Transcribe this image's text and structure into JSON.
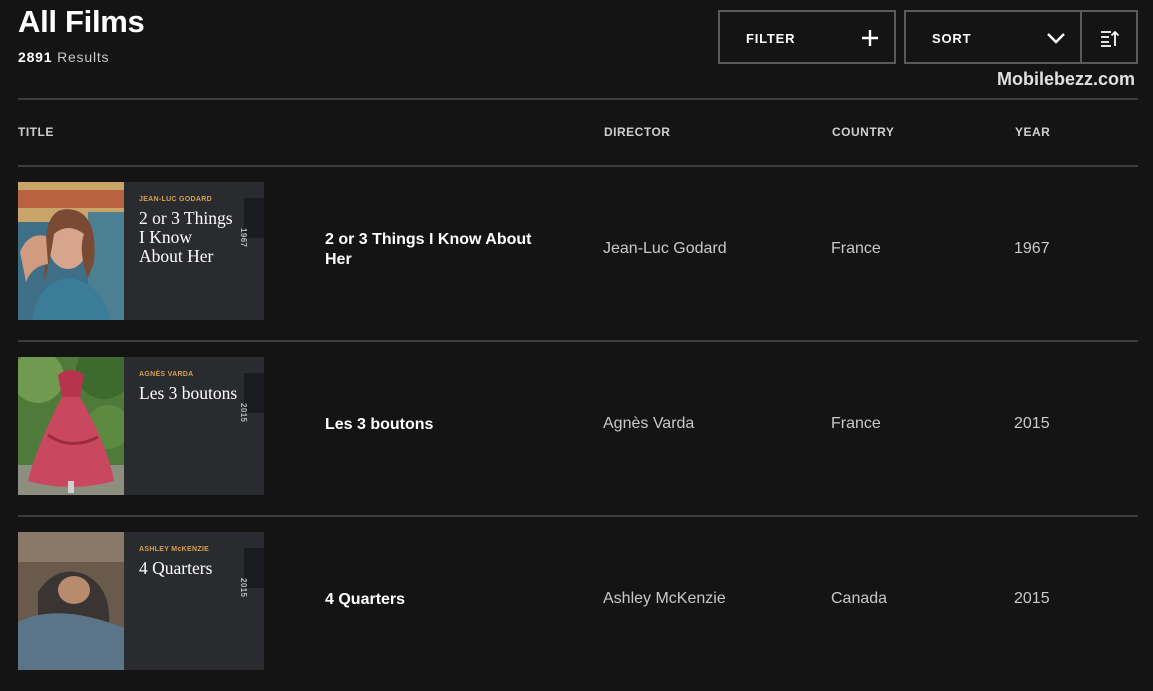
{
  "header": {
    "title": "All Films",
    "results_count": "2891",
    "results_label": "Results"
  },
  "toolbar": {
    "filter_label": "FILTER",
    "sort_label": "SORT",
    "filter_icon": "plus-icon",
    "sort_icon": "chevron-down-icon",
    "order_icon": "sort-order-icon"
  },
  "watermark": "Mobilebezz.com",
  "columns": {
    "title": "TITLE",
    "director": "DIRECTOR",
    "country": "COUNTRY",
    "year": "YEAR"
  },
  "films": [
    {
      "title": "2 or 3 Things I Know About Her",
      "director": "Jean-Luc Godard",
      "country": "France",
      "year": "1967",
      "card_director": "JEAN-LUC GODARD",
      "card_title": "2 or 3 Things I Know About Her",
      "card_year": "1967"
    },
    {
      "title": "Les 3 boutons",
      "director": "Agnès Varda",
      "country": "France",
      "year": "2015",
      "card_director": "AGNÈS VARDA",
      "card_title": "Les 3 boutons",
      "card_year": "2015"
    },
    {
      "title": "4 Quarters",
      "director": "Ashley McKenzie",
      "country": "Canada",
      "year": "2015",
      "card_director": "ASHLEY McKENZIE",
      "card_title": "4 Quarters",
      "card_year": "2015"
    }
  ],
  "colors": {
    "background": "#141414",
    "accent_director": "#d6a14d",
    "divider": "#3c3c3c"
  }
}
